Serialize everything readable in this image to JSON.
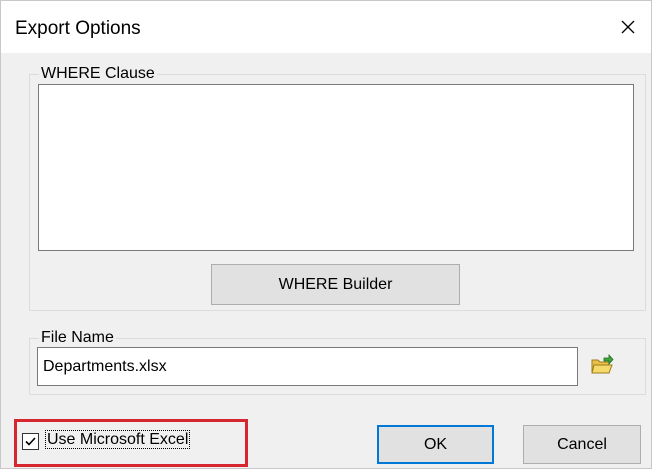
{
  "window": {
    "title": "Export Options"
  },
  "where_group": {
    "label": "WHERE Clause",
    "value": ""
  },
  "where_builder_label": "WHERE Builder",
  "file_group": {
    "label": "File Name",
    "value": "Departments.xlsx"
  },
  "checkbox": {
    "label": "Use Microsoft Excel",
    "checked": true
  },
  "buttons": {
    "ok": "OK",
    "cancel": "Cancel"
  },
  "icons": {
    "close": "close-icon",
    "folder": "open-folder-icon",
    "check": "checkmark-icon"
  },
  "colors": {
    "highlight": "#d6262f",
    "default_button_border": "#0078d7"
  }
}
